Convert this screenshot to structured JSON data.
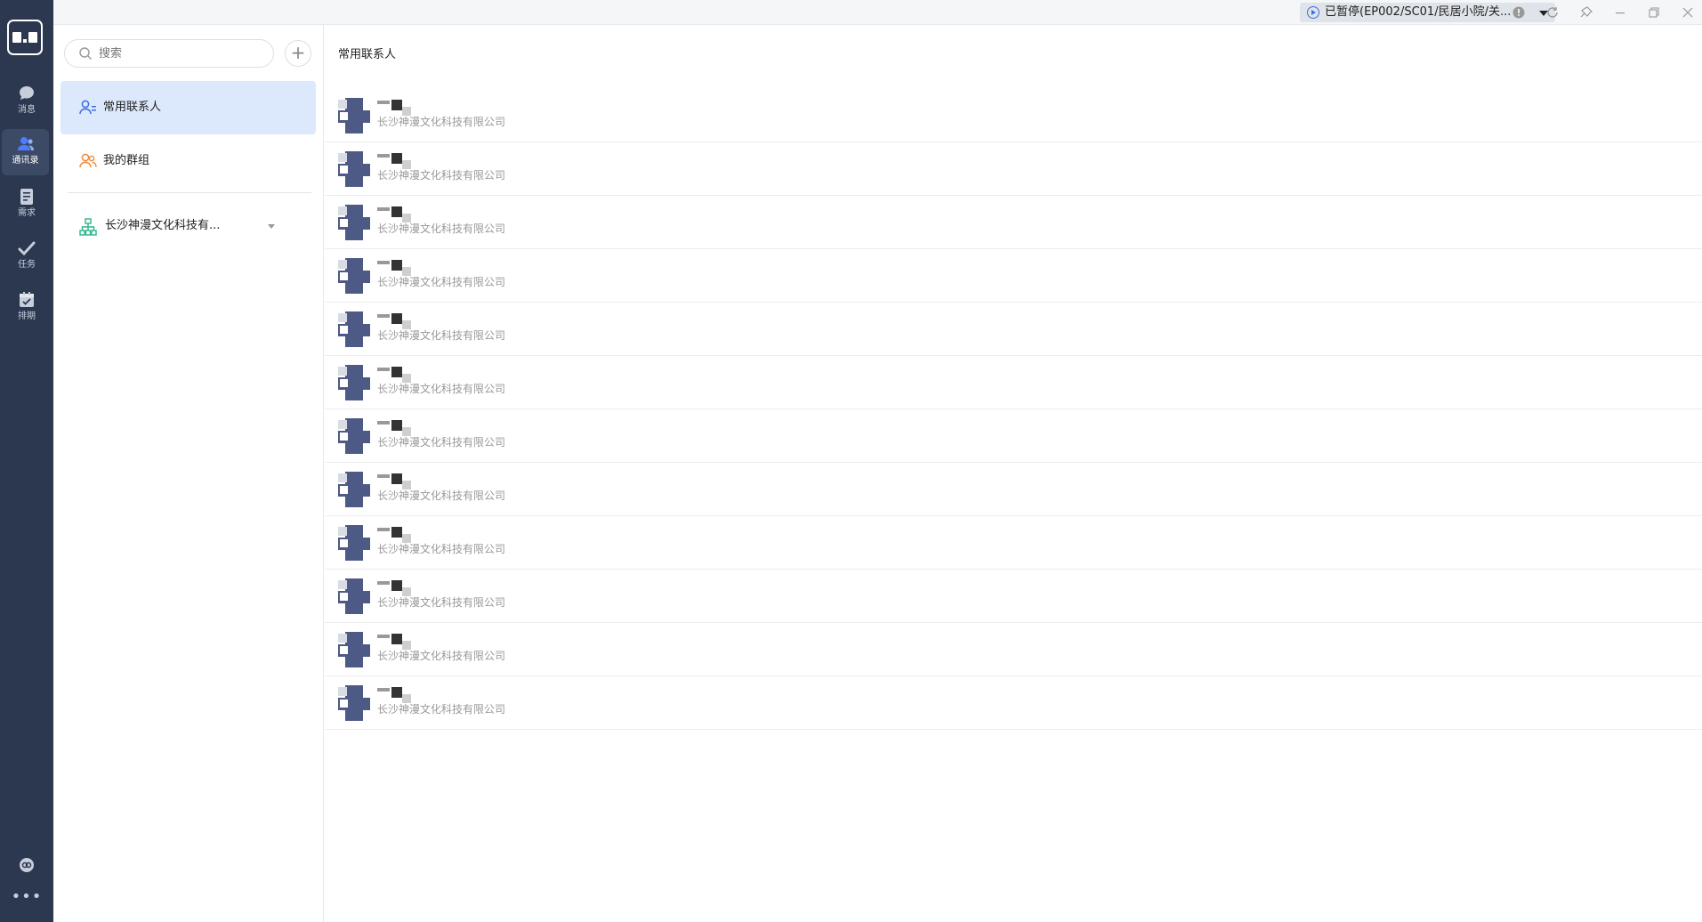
{
  "rail": {
    "items": [
      {
        "label": "消息",
        "icon": "chat-icon"
      },
      {
        "label": "通讯录",
        "icon": "contacts-icon",
        "active": true
      },
      {
        "label": "需求",
        "icon": "document-icon"
      },
      {
        "label": "任务",
        "icon": "check-icon"
      },
      {
        "label": "排期",
        "icon": "calendar-icon"
      }
    ]
  },
  "titlebar": {
    "status": "已暂停(EP002/SC01/民居小院/关..."
  },
  "panel": {
    "search_placeholder": "搜索",
    "add_label": "+",
    "menu": [
      {
        "label": "常用联系人",
        "active": true
      },
      {
        "label": "我的群组"
      }
    ],
    "org": {
      "label": "长沙神漫文化科技有..."
    }
  },
  "main": {
    "title": "常用联系人",
    "contacts": [
      {
        "company": "长沙神漫文化科技有限公司"
      },
      {
        "company": "长沙神漫文化科技有限公司"
      },
      {
        "company": "长沙神漫文化科技有限公司"
      },
      {
        "company": "长沙神漫文化科技有限公司"
      },
      {
        "company": "长沙神漫文化科技有限公司"
      },
      {
        "company": "长沙神漫文化科技有限公司"
      },
      {
        "company": "长沙神漫文化科技有限公司"
      },
      {
        "company": "长沙神漫文化科技有限公司"
      },
      {
        "company": "长沙神漫文化科技有限公司"
      },
      {
        "company": "长沙神漫文化科技有限公司"
      },
      {
        "company": "长沙神漫文化科技有限公司"
      },
      {
        "company": "长沙神漫文化科技有限公司"
      }
    ]
  },
  "colors": {
    "rail_bg": "#2c3750",
    "active_menu_bg": "#dce8fb",
    "accent": "#3d6fe0"
  }
}
